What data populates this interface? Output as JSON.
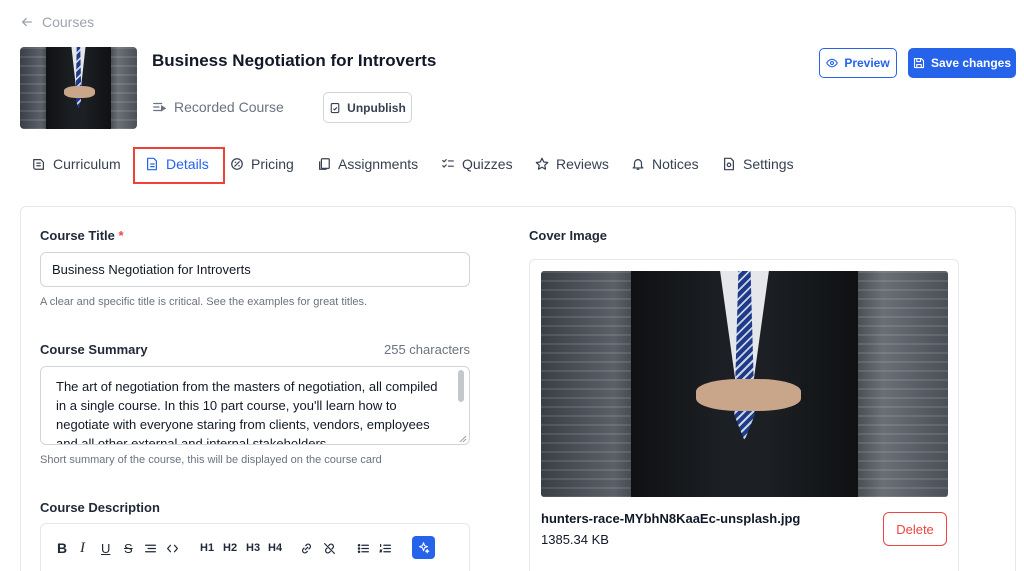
{
  "nav": {
    "back_label": "Courses"
  },
  "course": {
    "title": "Business Negotiation for Introverts",
    "type_label": "Recorded Course",
    "unpublish_label": "Unpublish"
  },
  "actions": {
    "preview_label": "Preview",
    "save_label": "Save changes"
  },
  "tabs": [
    {
      "label": "Curriculum",
      "icon": "curriculum-icon"
    },
    {
      "label": "Details",
      "icon": "document-icon",
      "active": true
    },
    {
      "label": "Pricing",
      "icon": "pricing-icon"
    },
    {
      "label": "Assignments",
      "icon": "copy-icon"
    },
    {
      "label": "Quizzes",
      "icon": "checklist-icon"
    },
    {
      "label": "Reviews",
      "icon": "star-icon"
    },
    {
      "label": "Notices",
      "icon": "bell-icon"
    },
    {
      "label": "Settings",
      "icon": "settings-doc-icon"
    }
  ],
  "form": {
    "title_label": "Course Title",
    "required_mark": "*",
    "title_value": "Business Negotiation for Introverts",
    "title_hint": "A clear and specific title is critical. See the examples for great titles.",
    "summary_label": "Course Summary",
    "summary_count": "255 characters",
    "summary_value": "The art of negotiation from the masters of negotiation, all compiled in a single course. In this 10 part course, you'll learn how to negotiate with everyone staring from clients, vendors, employees and all other external and internal stakeholders.",
    "summary_hint": "Short summary of the course, this will be displayed on the course card",
    "description_label": "Course Description",
    "toolbar": [
      "B",
      "I",
      "U",
      "S",
      "H1",
      "H2",
      "H3",
      "H4"
    ]
  },
  "cover": {
    "label": "Cover Image",
    "filename": "hunters-race-MYbhN8KaaEc-unsplash.jpg",
    "filesize": "1385.34 KB",
    "delete_label": "Delete"
  },
  "colors": {
    "accent": "#2563eb",
    "danger": "#ef4444",
    "highlight": "#ef4135"
  }
}
